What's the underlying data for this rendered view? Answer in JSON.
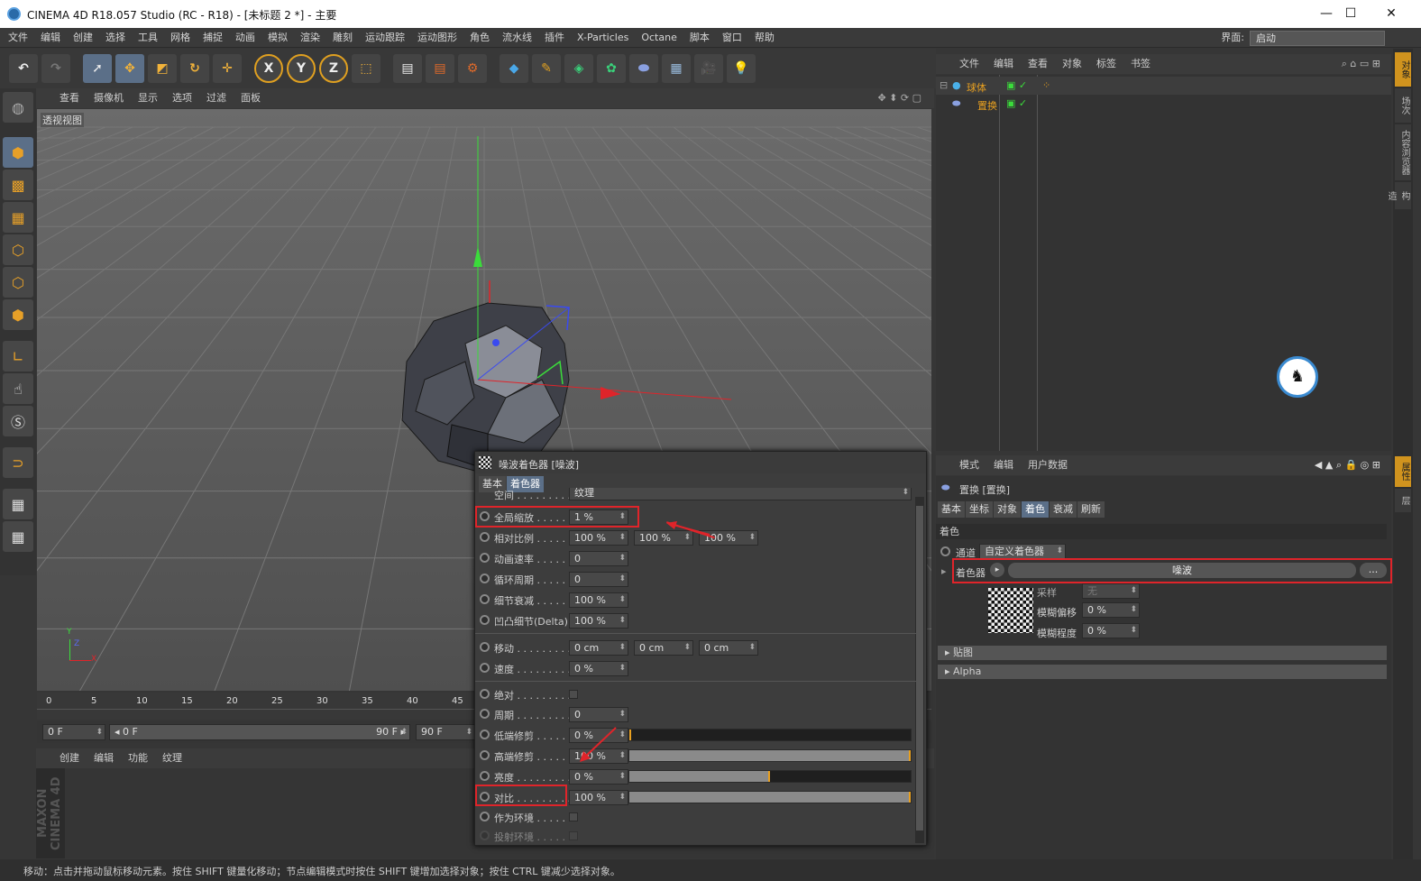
{
  "window": {
    "title": "CINEMA 4D R18.057 Studio (RC - R18) - [未标题 2 *] - 主要",
    "min": "—",
    "max": "☐",
    "close": "✕"
  },
  "menu": [
    "文件",
    "编辑",
    "创建",
    "选择",
    "工具",
    "网格",
    "捕捉",
    "动画",
    "模拟",
    "渲染",
    "雕刻",
    "运动跟踪",
    "运动图形",
    "角色",
    "流水线",
    "插件",
    "X-Particles",
    "Octane",
    "脚本",
    "窗口",
    "帮助"
  ],
  "layout": {
    "label": "界面:",
    "value": "启动"
  },
  "toolbar": {
    "x": "X",
    "y": "Y",
    "z": "Z"
  },
  "viewport": {
    "menu": [
      "查看",
      "摄像机",
      "显示",
      "选项",
      "过滤",
      "面板"
    ],
    "label": "透视视图",
    "axes": {
      "y": "Y",
      "z": "Z",
      "x": "X"
    }
  },
  "timeline": {
    "ticks": [
      "0",
      "5",
      "10",
      "15",
      "20",
      "25",
      "30",
      "35",
      "40",
      "45"
    ]
  },
  "frames": {
    "start": "0 F",
    "range_start": "◂ 0 F",
    "range_end": "90 F ▸",
    "end": "90 F"
  },
  "material_menu": [
    "创建",
    "编辑",
    "功能",
    "纹理"
  ],
  "status": "移动：点击并拖动鼠标移动元素。按住 SHIFT 键量化移动；节点编辑模式时按住 SHIFT 键增加选择对象；按住 CTRL 键减少选择对象。",
  "objects": {
    "menu": [
      "文件",
      "编辑",
      "查看",
      "对象",
      "标签",
      "书签"
    ],
    "items": [
      {
        "name": "球体"
      },
      {
        "name": "置换"
      }
    ]
  },
  "attributes": {
    "menu": [
      "模式",
      "编辑",
      "用户数据"
    ],
    "title": "置换 [置换]",
    "tabs": [
      "基本",
      "坐标",
      "对象",
      "着色",
      "衰减",
      "刷新"
    ],
    "active_tab": "着色",
    "section": "着色",
    "channel_label": "通道",
    "channel_value": "自定义着色器",
    "shader_label": "着色器",
    "shader_value": "噪波",
    "shader_more": "...",
    "sampling_label": "采样",
    "sampling_value": "无",
    "blur_offset_label": "模糊偏移",
    "blur_offset_value": "0 %",
    "blur_scale_label": "模糊程度",
    "blur_scale_value": "0 %",
    "group_map": "贴图",
    "group_alpha": "Alpha"
  },
  "side_tabs": [
    "对象",
    "场次",
    "内容浏览器",
    "构造",
    "属性",
    "层"
  ],
  "dialog": {
    "title": "噪波着色器 [噪波]",
    "tabs": [
      "基本",
      "着色器"
    ],
    "space_label": "空间 . . . . . . . . .",
    "space_value": "纹理",
    "global_scale_label": "全局缩放 . . . . . .",
    "global_scale_value": "1 %",
    "rel_scale_label": "相对比例 . . . . . .",
    "rel_scale_values": [
      "100 %",
      "100 %",
      "100 %"
    ],
    "anim_speed_label": "动画速率 . . . . . .",
    "anim_speed_value": "0",
    "loop_label": "循环周期 . . . . . .",
    "loop_value": "0",
    "detail_label": "细节衰减 . . . . . .",
    "detail_value": "100 %",
    "bump_label": "凹凸细节(Delta)",
    "bump_value": "100 %",
    "move_label": "移动 . . . . . . . . .",
    "move_values": [
      "0 cm",
      "0 cm",
      "0 cm"
    ],
    "speed_label": "速度 . . . . . . . . .",
    "speed_value": "0 %",
    "absolute_label": "绝对 . . . . . . . . .",
    "period_label": "周期 . . . . . . . . .",
    "period_value": "0",
    "low_clip_label": "低端修剪 . . . . . .",
    "low_clip_value": "0 %",
    "low_clip_level": 0,
    "high_clip_label": "高端修剪 . . . . . .",
    "high_clip_value": "100 %",
    "high_clip_level": 1,
    "brightness_label": "亮度 . . . . . . . . .",
    "brightness_value": "0 %",
    "brightness_level": 0.5,
    "contrast_label": "对比 . . . . . . . . .",
    "contrast_value": "100 %",
    "contrast_level": 1,
    "env_label": "作为环境 . . . . . .",
    "proj_env_label": "投射环境 . . . . . ."
  },
  "colors": {
    "highlight": "#e0242a",
    "accent": "#5b6f88",
    "orange": "#d0931e"
  }
}
